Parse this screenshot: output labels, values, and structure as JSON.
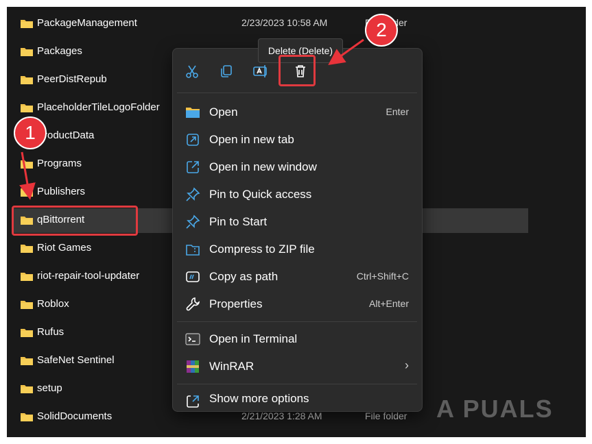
{
  "files": [
    {
      "name": "PackageManagement",
      "date": "2/23/2023 10:58 AM",
      "type": "File folder"
    },
    {
      "name": "Packages",
      "date": "",
      "type": ""
    },
    {
      "name": "PeerDistRepub",
      "date": "",
      "type": ""
    },
    {
      "name": "PlaceholderTileLogoFolder",
      "date": "",
      "type": ""
    },
    {
      "name": "ProductData",
      "date": "",
      "type": ""
    },
    {
      "name": "Programs",
      "date": "",
      "type": ""
    },
    {
      "name": "Publishers",
      "date": "",
      "type": ""
    },
    {
      "name": "qBittorrent",
      "date": "",
      "type": ""
    },
    {
      "name": "Riot Games",
      "date": "",
      "type": ""
    },
    {
      "name": "riot-repair-tool-updater",
      "date": "",
      "type": ""
    },
    {
      "name": "Roblox",
      "date": "",
      "type": ""
    },
    {
      "name": "Rufus",
      "date": "",
      "type": ""
    },
    {
      "name": "SafeNet Sentinel",
      "date": "",
      "type": ""
    },
    {
      "name": "setup",
      "date": "",
      "type": ""
    },
    {
      "name": "SolidDocuments",
      "date": "2/21/2023 1:28 AM",
      "type": "File folder"
    }
  ],
  "context_menu": {
    "toolbar": [
      {
        "icon": "scissors-icon",
        "label": "Cut"
      },
      {
        "icon": "copy-icon",
        "label": "Copy"
      },
      {
        "icon": "rename-icon",
        "label": "Rename"
      },
      {
        "icon": "trash-icon",
        "label": "Delete"
      }
    ],
    "items": [
      {
        "label": "Open",
        "shortcut": "Enter",
        "icon": "folder-icon"
      },
      {
        "label": "Open in new tab",
        "shortcut": "",
        "icon": "open-new-tab-icon"
      },
      {
        "label": "Open in new window",
        "shortcut": "",
        "icon": "open-new-window-icon"
      },
      {
        "label": "Pin to Quick access",
        "shortcut": "",
        "icon": "pin-icon"
      },
      {
        "label": "Pin to Start",
        "shortcut": "",
        "icon": "pin-icon"
      },
      {
        "label": "Compress to ZIP file",
        "shortcut": "",
        "icon": "zip-icon"
      },
      {
        "label": "Copy as path",
        "shortcut": "Ctrl+Shift+C",
        "icon": "copy-path-icon"
      },
      {
        "label": "Properties",
        "shortcut": "Alt+Enter",
        "icon": "wrench-icon"
      },
      {
        "label": "Open in Terminal",
        "shortcut": "",
        "icon": "terminal-icon"
      },
      {
        "label": "WinRAR",
        "shortcut": "",
        "icon": "winrar-icon"
      },
      {
        "label": "Show more options",
        "shortcut": "",
        "icon": "show-more-icon"
      }
    ]
  },
  "tooltip": "Delete (Delete)",
  "annotations": {
    "step1": "1",
    "step2": "2"
  },
  "watermark": "A  PUALS",
  "colors": {
    "accent_blue": "#4aa8e8",
    "folder_yellow": "#f0c24a",
    "highlight_red": "#e03a3f"
  }
}
